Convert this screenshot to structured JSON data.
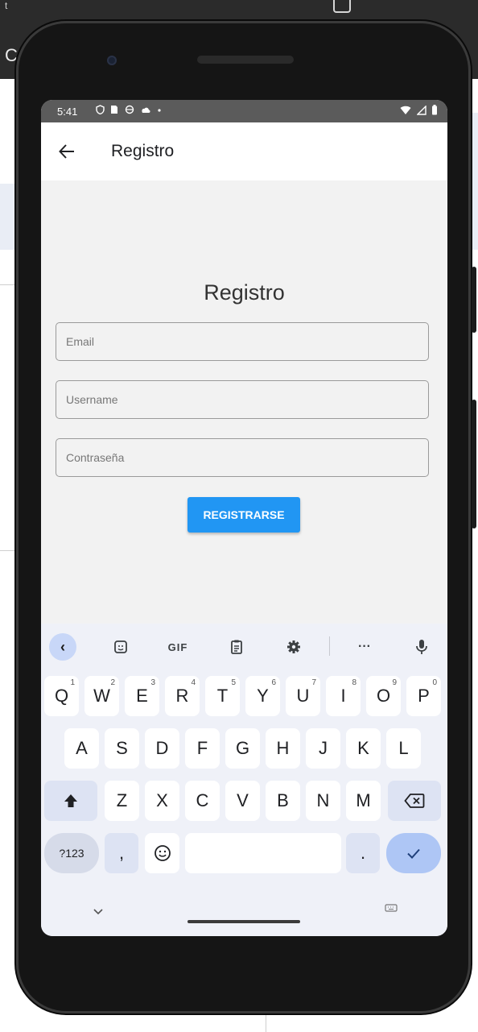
{
  "status_bar": {
    "time": "5:41",
    "left_icons": [
      "shield-icon",
      "sim-icon",
      "sync-icon",
      "cloud-icon",
      "dot-icon"
    ],
    "right_icons": [
      "wifi-icon",
      "signal-icon",
      "battery-icon"
    ]
  },
  "app_bar": {
    "back_icon": "arrow-left-icon",
    "title": "Registro"
  },
  "form": {
    "heading": "Registro",
    "email_placeholder": "Email",
    "username_placeholder": "Username",
    "password_placeholder": "Contraseña",
    "submit_label": "REGISTRARSE",
    "accent_color": "#2196f3"
  },
  "keyboard": {
    "toolbar": {
      "back_label": "‹",
      "gif_label": "GIF",
      "more_label": "···"
    },
    "row1": [
      {
        "key": "Q",
        "hint": "1"
      },
      {
        "key": "W",
        "hint": "2"
      },
      {
        "key": "E",
        "hint": "3"
      },
      {
        "key": "R",
        "hint": "4"
      },
      {
        "key": "T",
        "hint": "5"
      },
      {
        "key": "Y",
        "hint": "6"
      },
      {
        "key": "U",
        "hint": "7"
      },
      {
        "key": "I",
        "hint": "8"
      },
      {
        "key": "O",
        "hint": "9"
      },
      {
        "key": "P",
        "hint": "0"
      }
    ],
    "row2": [
      "A",
      "S",
      "D",
      "F",
      "G",
      "H",
      "J",
      "K",
      "L"
    ],
    "row3": [
      "Z",
      "X",
      "C",
      "V",
      "B",
      "N",
      "M"
    ],
    "row4": {
      "symbols_label": "?123",
      "comma_label": ",",
      "period_label": "."
    }
  }
}
